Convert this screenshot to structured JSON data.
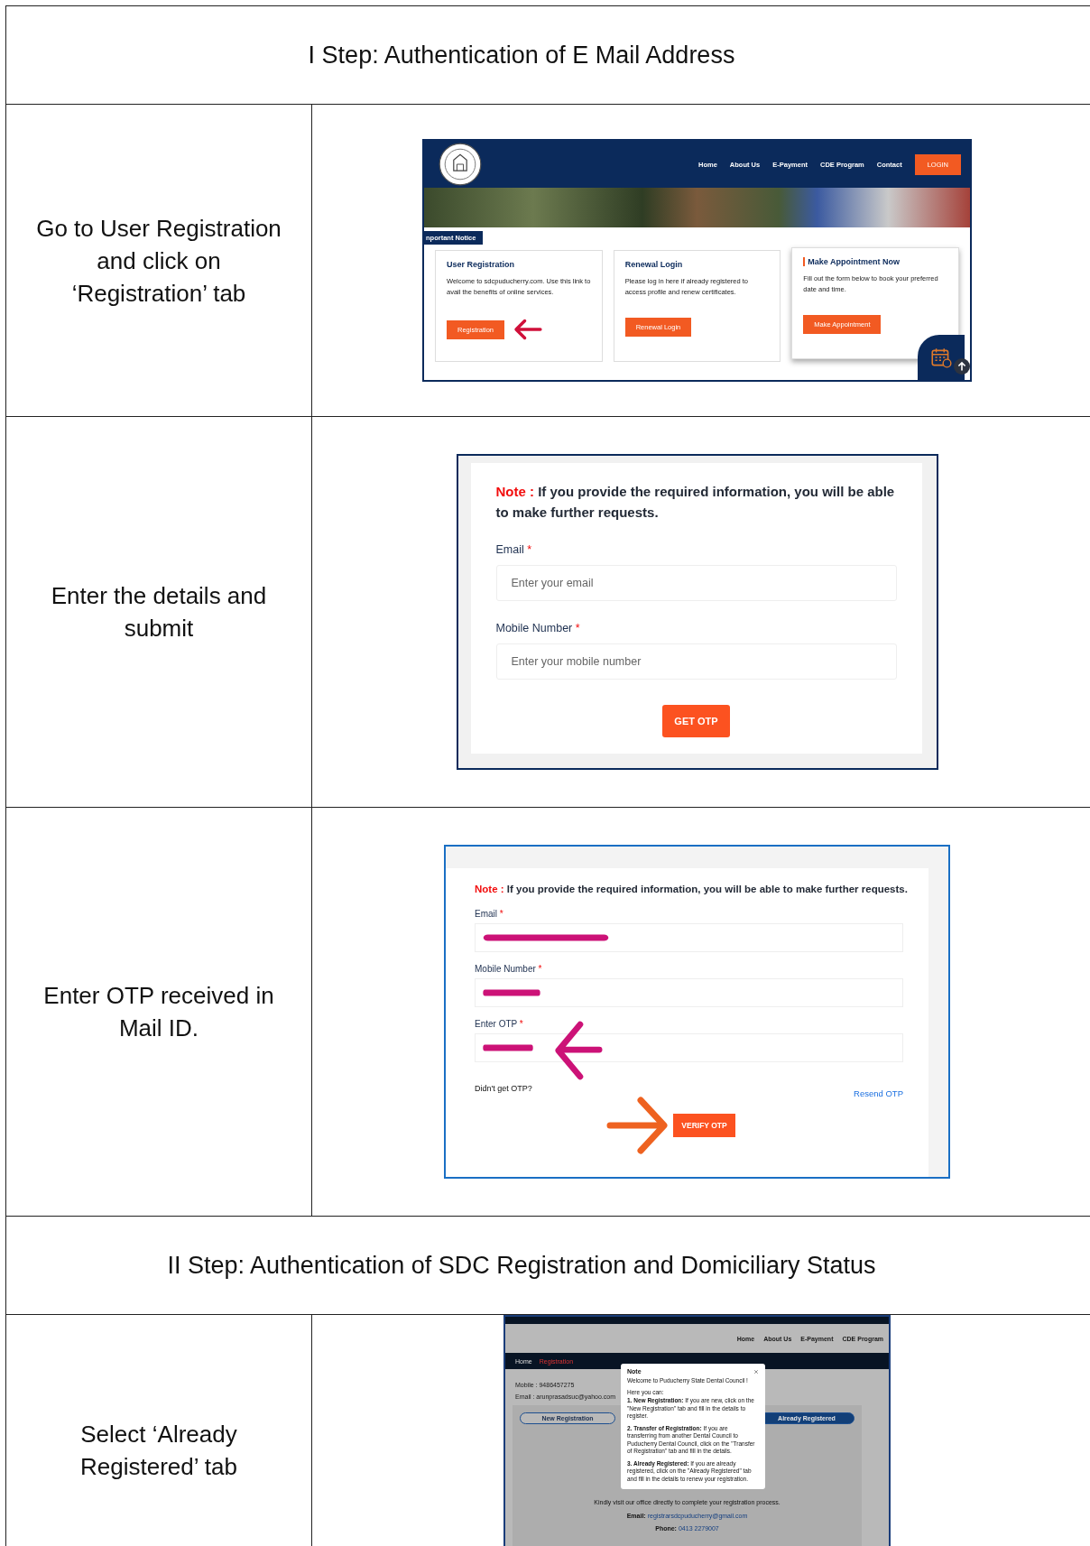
{
  "rows": [
    {
      "kind": "heading",
      "text": "I Step: Authentication of E Mail Address"
    },
    {
      "kind": "step",
      "instruction": "Go to User Registration and click on ‘Registration’ tab",
      "screen": {
        "kind": "home",
        "nav": [
          "Home",
          "About Us",
          "E-Payment",
          "CDE Program",
          "Contact"
        ],
        "login": "LOGIN",
        "notice": "nportant Notice",
        "cards": [
          {
            "title": "User Registration",
            "text": "Welcome to sdcpuducherry.com. Use this link to avail the benefits of online services.",
            "button": "Registration",
            "pointed": true,
            "accent": false
          },
          {
            "title": "Renewal Login",
            "text": "Please log in here if already registered to access profile and renew certificates.",
            "button": "Renewal Login",
            "pointed": false,
            "accent": false
          },
          {
            "title": "Make Appointment Now",
            "text": "Fill out the form below to book your preferred date and time.",
            "button": "Make Appointment",
            "pointed": false,
            "accent": true
          }
        ]
      }
    },
    {
      "kind": "step",
      "instruction": "Enter the details and submit",
      "screen": {
        "kind": "form",
        "note_label": "Note :",
        "note": "If you provide the required information, you will be able to make further requests.",
        "fields": [
          {
            "label": "Email",
            "required_mark": "*",
            "placeholder": "Enter your email"
          },
          {
            "label": "Mobile Number",
            "required_mark": "*",
            "placeholder": "Enter your mobile number"
          }
        ],
        "button": "GET OTP"
      }
    },
    {
      "kind": "step",
      "instruction": "Enter OTP received in Mail ID.",
      "screen": {
        "kind": "otp",
        "note_label": "Note :",
        "note": "If you provide the required information, you will be able to make further requests.",
        "fields": [
          {
            "label": "Email",
            "required_mark": "*",
            "pointed": false
          },
          {
            "label": "Mobile Number",
            "required_mark": "*",
            "pointed": false
          },
          {
            "label": "Enter OTP",
            "required_mark": "*",
            "pointed": true
          }
        ],
        "hint": "Didn't get OTP?",
        "resend": "Resend OTP",
        "button": "VERIFY OTP"
      }
    },
    {
      "kind": "heading",
      "text": "II Step: Authentication of SDC Registration and Domiciliary Status"
    },
    {
      "kind": "step",
      "instruction": "Select ‘Already Registered’ tab",
      "screen": {
        "kind": "modal",
        "nav": [
          "Home",
          "About Us",
          "E-Payment",
          "CDE Program"
        ],
        "crumbs": [
          "Home",
          "Registration"
        ],
        "info": [
          "Mobile : 9486457275",
          "Email : arunprasadsuc@yahoo.com"
        ],
        "tabs": [
          {
            "label": "New Registration",
            "selected": false
          },
          {
            "label": "Already Registered",
            "selected": true
          }
        ],
        "office": "Kindly visit our office directly to complete your registration process.",
        "contacts": [
          {
            "label": "Email:",
            "value": "registrarsdcpuducherry@gmail.com"
          },
          {
            "label": "Phone:",
            "value": "0413 2279007"
          }
        ],
        "modal": {
          "title": "Note",
          "welcome": "Welcome to Puducherry State Dental Council !",
          "intro": "Here you can:",
          "items": [
            "**1. New Registration:** If you are new, click on the \"New Registration\" tab and fill in the details to register.",
            "**2. Transfer of Registration:** If you are transferring from another Dental Council to Puducherry Dental Council, click on the \"Transfer of Registration\" tab and fill in the details.",
            "**3. Already Registered:** If you are already registered, click on the \"Already Registered\" tab and fill in the details to renew your registration."
          ]
        }
      }
    }
  ]
}
